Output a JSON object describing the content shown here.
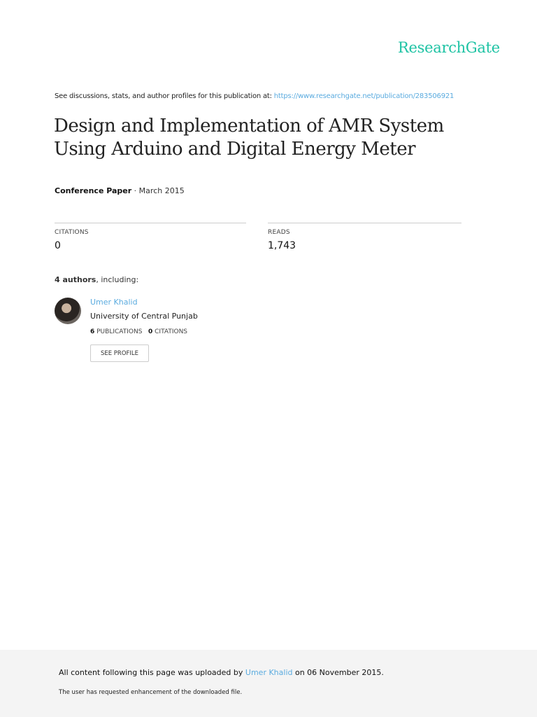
{
  "brand": "ResearchGate",
  "header": {
    "discussion_text": "See discussions, stats, and author profiles for this publication at: ",
    "publication_url": "https://www.researchgate.net/publication/283506921"
  },
  "publication": {
    "title": "Design and Implementation of AMR System Using Arduino and Digital Energy Meter",
    "type": "Conference Paper",
    "date": " · March 2015"
  },
  "stats": {
    "citations_label": "CITATIONS",
    "citations": "0",
    "reads_label": "READS",
    "reads": "1,743"
  },
  "authors": {
    "count": "4 authors",
    "suffix": ", including:",
    "list": [
      {
        "name": "Umer Khalid",
        "affiliation": "University of Central Punjab",
        "publications": "6",
        "publications_label": " PUBLICATIONS",
        "citations": "0",
        "citations_label": " CITATIONS",
        "button": "SEE PROFILE"
      }
    ]
  },
  "footer": {
    "prefix": "All content following this page was uploaded by ",
    "uploader": "Umer Khalid",
    "suffix": " on 06 November 2015.",
    "note": "The user has requested enhancement of the downloaded file."
  },
  "colors": {
    "brand": "#1ec3a4",
    "link": "#5aabdf",
    "footer_bg": "#f4f4f4"
  }
}
